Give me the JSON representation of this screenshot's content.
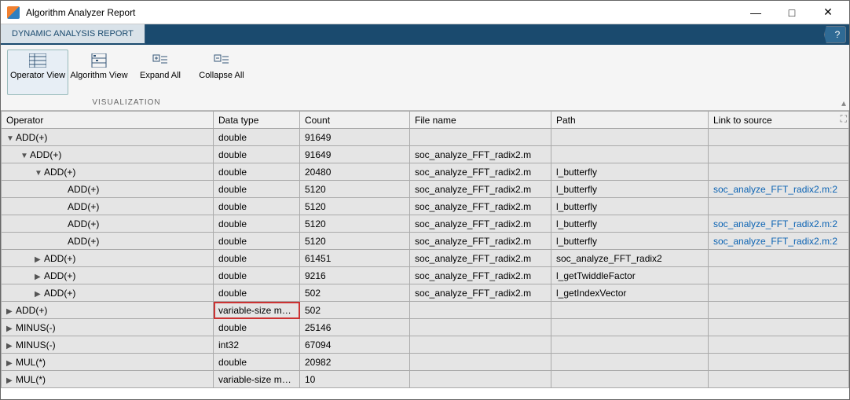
{
  "window": {
    "title": "Algorithm Analyzer Report"
  },
  "tabstrip": {
    "tab_label": "DYNAMIC ANALYSIS REPORT"
  },
  "toolstrip": {
    "buttons": {
      "operator_view": "Operator View",
      "algorithm_view": "Algorithm View",
      "expand_all": "Expand All",
      "collapse_all": "Collapse All"
    },
    "group_label": "VISUALIZATION"
  },
  "columns": {
    "operator": "Operator",
    "datatype": "Data type",
    "count": "Count",
    "filename": "File name",
    "path": "Path",
    "link": "Link to source"
  },
  "rows": [
    {
      "indent": 0,
      "tree": "open",
      "op": "ADD(+)",
      "dt": "double",
      "ct": "91649",
      "fn": "",
      "pt": "",
      "ln": ""
    },
    {
      "indent": 1,
      "tree": "open",
      "op": "ADD(+)",
      "dt": "double",
      "ct": "91649",
      "fn": "soc_analyze_FFT_radix2.m",
      "pt": "",
      "ln": ""
    },
    {
      "indent": 2,
      "tree": "open",
      "op": "ADD(+)",
      "dt": "double",
      "ct": "20480",
      "fn": "soc_analyze_FFT_radix2.m",
      "pt": "l_butterfly",
      "ln": ""
    },
    {
      "indent": 3,
      "tree": "none",
      "op": "ADD(+)",
      "dt": "double",
      "ct": "5120",
      "fn": "soc_analyze_FFT_radix2.m",
      "pt": "l_butterfly",
      "ln": "soc_analyze_FFT_radix2.m:2"
    },
    {
      "indent": 3,
      "tree": "none",
      "op": "ADD(+)",
      "dt": "double",
      "ct": "5120",
      "fn": "soc_analyze_FFT_radix2.m",
      "pt": "l_butterfly",
      "ln": ""
    },
    {
      "indent": 3,
      "tree": "none",
      "op": "ADD(+)",
      "dt": "double",
      "ct": "5120",
      "fn": "soc_analyze_FFT_radix2.m",
      "pt": "l_butterfly",
      "ln": "soc_analyze_FFT_radix2.m:2"
    },
    {
      "indent": 3,
      "tree": "none",
      "op": "ADD(+)",
      "dt": "double",
      "ct": "5120",
      "fn": "soc_analyze_FFT_radix2.m",
      "pt": "l_butterfly",
      "ln": "soc_analyze_FFT_radix2.m:2"
    },
    {
      "indent": 2,
      "tree": "closed",
      "op": "ADD(+)",
      "dt": "double",
      "ct": "61451",
      "fn": "soc_analyze_FFT_radix2.m",
      "pt": "soc_analyze_FFT_radix2",
      "ln": ""
    },
    {
      "indent": 2,
      "tree": "closed",
      "op": "ADD(+)",
      "dt": "double",
      "ct": "9216",
      "fn": "soc_analyze_FFT_radix2.m",
      "pt": "l_getTwiddleFactor",
      "ln": ""
    },
    {
      "indent": 2,
      "tree": "closed",
      "op": "ADD(+)",
      "dt": "double",
      "ct": "502",
      "fn": "soc_analyze_FFT_radix2.m",
      "pt": "l_getIndexVector",
      "ln": ""
    },
    {
      "indent": 0,
      "tree": "closed",
      "op": "ADD(+)",
      "dt": "variable-size ma…",
      "ct": "502",
      "fn": "",
      "pt": "",
      "ln": "",
      "dt_hl": true
    },
    {
      "indent": 0,
      "tree": "closed",
      "op": "MINUS(-)",
      "dt": "double",
      "ct": "25146",
      "fn": "",
      "pt": "",
      "ln": ""
    },
    {
      "indent": 0,
      "tree": "closed",
      "op": "MINUS(-)",
      "dt": "int32",
      "ct": "67094",
      "fn": "",
      "pt": "",
      "ln": ""
    },
    {
      "indent": 0,
      "tree": "closed",
      "op": "MUL(*)",
      "dt": "double",
      "ct": "20982",
      "fn": "",
      "pt": "",
      "ln": ""
    },
    {
      "indent": 0,
      "tree": "closed",
      "op": "MUL(*)",
      "dt": "variable-size ma…",
      "ct": "10",
      "fn": "",
      "pt": "",
      "ln": ""
    }
  ]
}
